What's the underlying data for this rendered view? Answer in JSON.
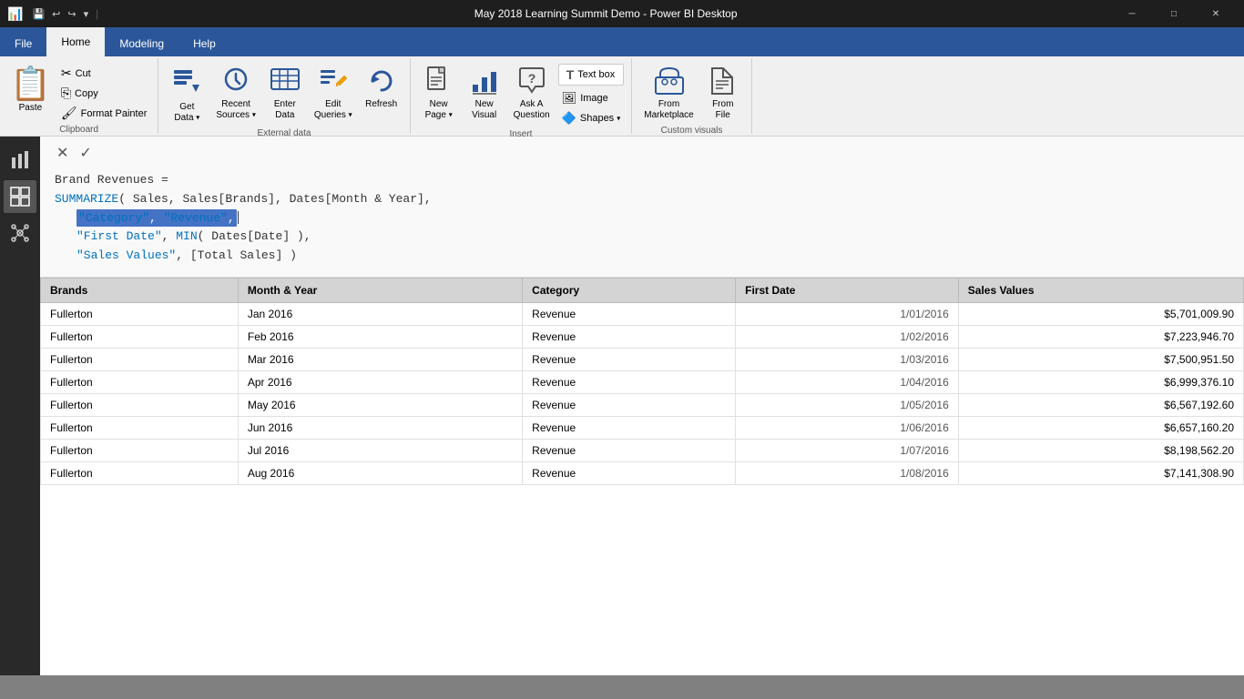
{
  "titleBar": {
    "appIcon": "📊",
    "controls": [
      "💾",
      "↩",
      "↪",
      "▾"
    ],
    "title": "May 2018 Learning Summit Demo - Power BI Desktop",
    "windowBtns": [
      "─",
      "□",
      "✕"
    ]
  },
  "ribbonTabs": [
    {
      "id": "file",
      "label": "File",
      "active": false
    },
    {
      "id": "home",
      "label": "Home",
      "active": true
    },
    {
      "id": "modeling",
      "label": "Modeling",
      "active": false
    },
    {
      "id": "help",
      "label": "Help",
      "active": false
    }
  ],
  "ribbon": {
    "groups": [
      {
        "id": "clipboard",
        "label": "Clipboard",
        "paste": "Paste",
        "cut": "✂ Cut",
        "copy": "📋 Copy",
        "formatPainter": "🖌 Format Painter"
      },
      {
        "id": "externalData",
        "label": "External data",
        "buttons": [
          {
            "id": "getdata",
            "label": "Get\nData",
            "icon": "📥",
            "dropdown": true
          },
          {
            "id": "recentSources",
            "label": "Recent\nSources",
            "icon": "🕐",
            "dropdown": true
          },
          {
            "id": "enterData",
            "label": "Enter\nData",
            "icon": "📊"
          },
          {
            "id": "editQueries",
            "label": "Edit\nQueries",
            "icon": "✏️",
            "dropdown": true
          },
          {
            "id": "refresh",
            "label": "Refresh",
            "icon": "🔄"
          }
        ]
      },
      {
        "id": "insert",
        "label": "Insert",
        "buttons": [
          {
            "id": "newPage",
            "label": "New\nPage",
            "icon": "📄",
            "dropdown": true
          },
          {
            "id": "newVisual",
            "label": "New\nVisual",
            "icon": "📊"
          },
          {
            "id": "askQuestion",
            "label": "Ask A\nQuestion",
            "icon": "💬"
          },
          {
            "id": "textbox",
            "label": "Text box",
            "icon": "T"
          },
          {
            "id": "image",
            "label": "Image",
            "icon": "🖼"
          },
          {
            "id": "shapes",
            "label": "Shapes",
            "icon": "🔷",
            "dropdown": true
          }
        ]
      },
      {
        "id": "customVisuals",
        "label": "Custom visuals",
        "buttons": [
          {
            "id": "fromMarketplace",
            "label": "From\nMarketplace",
            "icon": "🏪"
          },
          {
            "id": "fromFile",
            "label": "From\nFile",
            "icon": "📁"
          }
        ]
      }
    ]
  },
  "sectionLabels": [
    "Clipboard",
    "External data",
    "Insert",
    "Custom visuals"
  ],
  "sidebar": {
    "buttons": [
      {
        "id": "report",
        "icon": "📊",
        "active": false
      },
      {
        "id": "data",
        "icon": "⊞",
        "active": true
      },
      {
        "id": "model",
        "icon": "⧉",
        "active": false
      }
    ]
  },
  "formulaBar": {
    "title": "Brand Revenues =",
    "lines": [
      {
        "indent": 0,
        "text": "SUMMARIZE( Sales, Sales[Brands], Dates[Month & Year],"
      },
      {
        "indent": 1,
        "text": "\"Category\", \"Revenue\",",
        "highlighted": true
      },
      {
        "indent": 1,
        "text": "\"First Date\", MIN( Dates[Date] ),"
      },
      {
        "indent": 1,
        "text": "\"Sales Values\", [Total Sales] )"
      }
    ]
  },
  "table": {
    "columns": [
      "Brands",
      "Month & Year",
      "Category",
      "First Date",
      "Sales Values"
    ],
    "rows": [
      {
        "brand": "Fullerton",
        "month": "Jan 2016",
        "category": "Revenue",
        "date": "1/01/2016",
        "sales": "$5,701,009.90"
      },
      {
        "brand": "Fullerton",
        "month": "Feb 2016",
        "category": "Revenue",
        "date": "1/02/2016",
        "sales": "$7,223,946.70"
      },
      {
        "brand": "Fullerton",
        "month": "Mar 2016",
        "category": "Revenue",
        "date": "1/03/2016",
        "sales": "$7,500,951.50"
      },
      {
        "brand": "Fullerton",
        "month": "Apr 2016",
        "category": "Revenue",
        "date": "1/04/2016",
        "sales": "$6,999,376.10"
      },
      {
        "brand": "Fullerton",
        "month": "May 2016",
        "category": "Revenue",
        "date": "1/05/2016",
        "sales": "$6,567,192.60"
      },
      {
        "brand": "Fullerton",
        "month": "Jun 2016",
        "category": "Revenue",
        "date": "1/06/2016",
        "sales": "$6,657,160.20"
      },
      {
        "brand": "Fullerton",
        "month": "Jul 2016",
        "category": "Revenue",
        "date": "1/07/2016",
        "sales": "$8,198,562.20"
      },
      {
        "brand": "Fullerton",
        "month": "Aug 2016",
        "category": "Revenue",
        "date": "1/08/2016",
        "sales": "$7,141,308.90"
      }
    ]
  }
}
